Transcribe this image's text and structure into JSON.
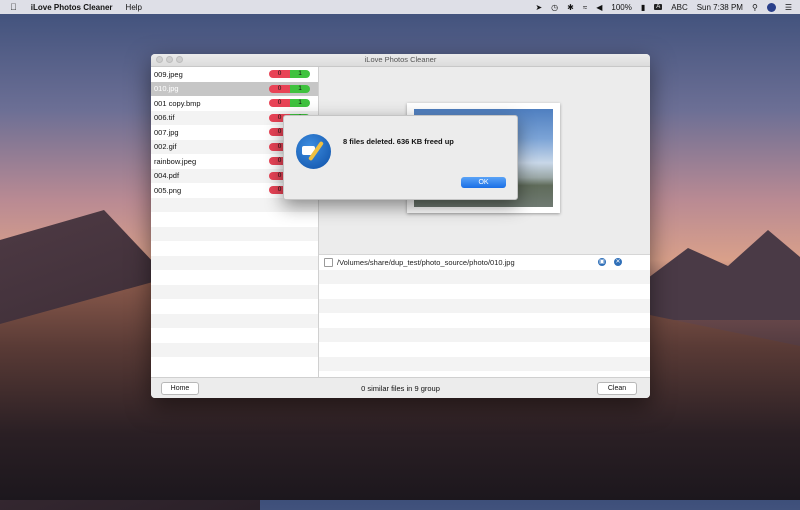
{
  "menubar": {
    "app_name": "iLove Photos Cleaner",
    "menus": [
      "Help"
    ],
    "battery": "100%",
    "input_label": "ABC",
    "clock": "Sun 7:38 PM"
  },
  "window": {
    "title": "iLove Photos Cleaner",
    "files": [
      {
        "name": "009.jpeg",
        "red": "0",
        "green": "1",
        "selected": false
      },
      {
        "name": "010.jpg",
        "red": "0",
        "green": "1",
        "selected": true
      },
      {
        "name": "001 copy.bmp",
        "red": "0",
        "green": "1",
        "selected": false
      },
      {
        "name": "006.tif",
        "red": "0",
        "green": "1",
        "selected": false
      },
      {
        "name": "007.jpg",
        "red": "0",
        "green": "1",
        "selected": false
      },
      {
        "name": "002.gif",
        "red": "0",
        "green": "1",
        "selected": false
      },
      {
        "name": "rainbow.jpeg",
        "red": "0",
        "green": "1",
        "selected": false
      },
      {
        "name": "004.pdf",
        "red": "0",
        "green": "1",
        "selected": false
      },
      {
        "name": "005.png",
        "red": "0",
        "green": "1",
        "selected": false
      }
    ],
    "path_entry": "/Volumes/share/dup_test/photo_source/photo/010.jpg",
    "home_label": "Home",
    "clean_label": "Clean",
    "status": "0 similar files in 9 group"
  },
  "alert": {
    "message": "8 files deleted. 636 KB freed up",
    "ok_label": "OK"
  }
}
